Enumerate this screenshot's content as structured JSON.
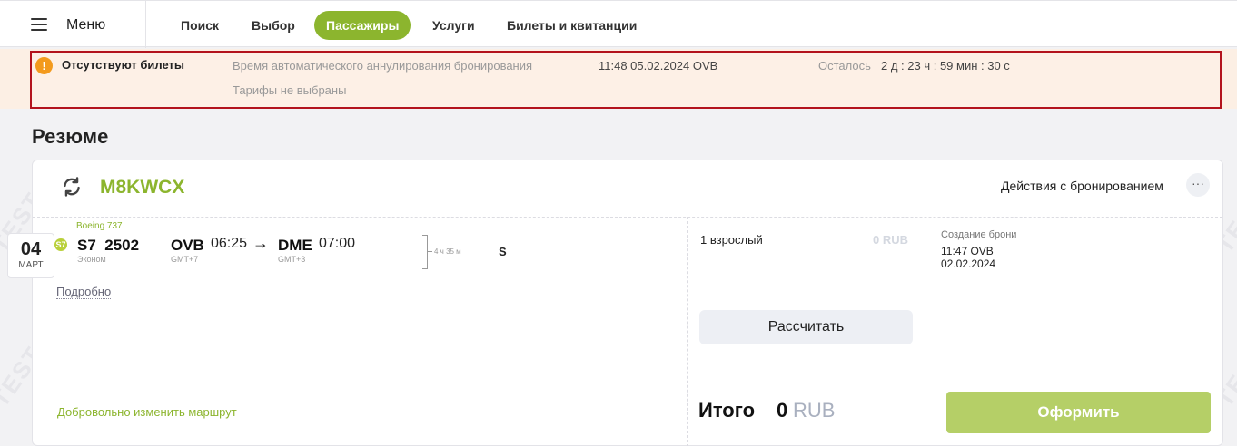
{
  "nav": {
    "menu_label": "Меню",
    "tabs": [
      {
        "label": "Поиск",
        "active": false
      },
      {
        "label": "Выбор",
        "active": false
      },
      {
        "label": "Пассажиры",
        "active": true
      },
      {
        "label": "Услуги",
        "active": false
      },
      {
        "label": "Билеты и квитанции",
        "active": false
      }
    ]
  },
  "alert": {
    "icon": "warning-icon",
    "title": "Отсутствуют билеты",
    "auto_cancel_label": "Время автоматического аннулирования бронирования",
    "auto_cancel_time": "11:48 05.02.2024 OVB",
    "remaining_label": "Осталось",
    "remaining_value": "2 д : 23 ч : 59 мин : 30 с",
    "tariffs_note": "Тарифы не выбраны"
  },
  "summary": {
    "title": "Резюме"
  },
  "booking": {
    "pnr": "M8KWCX",
    "actions_label": "Действия с бронированием",
    "more_glyph": "···",
    "segment": {
      "date_day": "04",
      "date_month": "МАРТ",
      "aircraft": "Boeing 737",
      "airline_badge": "S7",
      "flight_number": "S7  2502",
      "cabin": "Эконом",
      "dep_code": "OVB",
      "dep_time": "06:25",
      "dep_tz": "GMT+7",
      "arrow": "→",
      "arr_code": "DME",
      "arr_time": "07:00",
      "arr_tz": "GMT+3",
      "duration": "4 ч 35 м",
      "fare_class": "S",
      "details_link": "Подробно"
    },
    "change_route_link": "Добровольно изменить маршрут",
    "pricing": {
      "passengers": "1 взрослый",
      "passenger_price": "0 RUB",
      "calc_button": "Рассчитать",
      "total_label": "Итого",
      "total_amount": "0",
      "total_currency": "RUB"
    },
    "creation": {
      "label": "Создание брони",
      "time": "11:47 OVB",
      "date": "02.02.2024"
    },
    "issue_button": "Оформить"
  },
  "watermark": "TEST",
  "colors": {
    "accent_green": "#8cb52e",
    "alert_border": "#b3131d",
    "warning_orange": "#f39a1d"
  }
}
